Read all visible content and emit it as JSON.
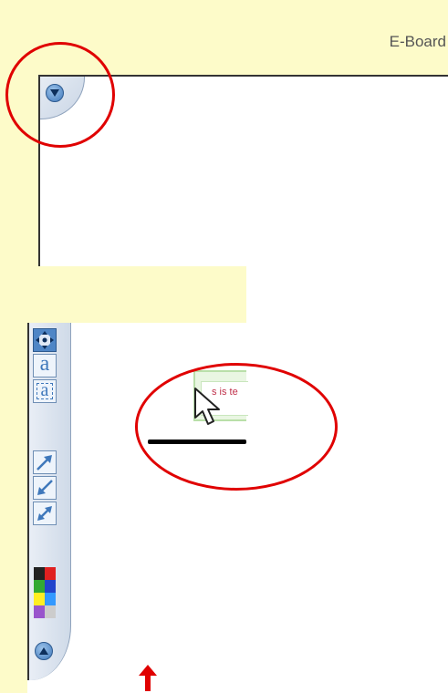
{
  "header": {
    "board_title": "E-Board"
  },
  "icons": {
    "corner_toggle": "down-arrow-circle-icon",
    "collapse_toggle": "up-arrow-circle-icon",
    "move_tool": "move-icon",
    "text_tool": "text-icon",
    "text_frame_tool": "text-frame-icon",
    "arrow_tool": "arrow-icon",
    "line_tool": "line-icon",
    "double_arrow_tool": "double-arrow-icon",
    "color_palette": "color-palette-icon",
    "cursor": "mouse-pointer-icon",
    "up_arrow": "up-arrow-icon"
  },
  "toolbar": {
    "text_tool_glyph": "a",
    "text_frame_tool_glyph": "a"
  },
  "canvas": {
    "text_box_text": "s is te"
  },
  "colors": {
    "header_bg": "#fdfbc9",
    "annotation": "#e00000",
    "toolbar_accent": "#3f78bb",
    "text_box_text": "#c0304a",
    "palette": [
      "#222222",
      "#e02020",
      "#33aa33",
      "#2244cc",
      "#ffee22",
      "#3399ff",
      "#9955cc",
      "#cccccc"
    ]
  }
}
